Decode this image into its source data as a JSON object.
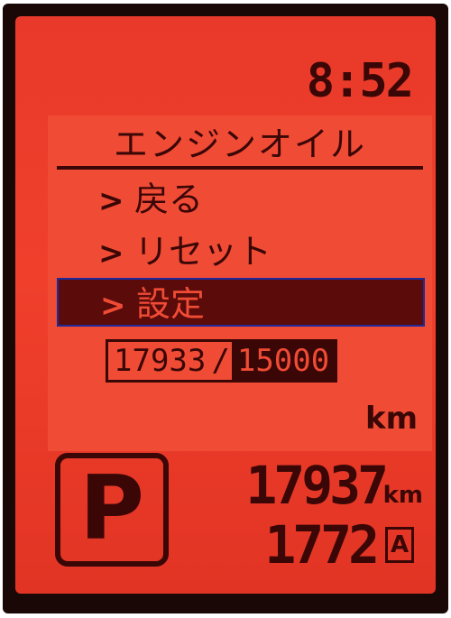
{
  "clock": {
    "time": "8:52"
  },
  "menu": {
    "title": "エンジンオイル",
    "items": [
      {
        "chevron": ">",
        "label": "戻る"
      },
      {
        "chevron": ">",
        "label": "リセット"
      },
      {
        "chevron": ">",
        "label": "設定",
        "selected": true
      }
    ]
  },
  "oil_counter": {
    "current": "17933",
    "separator": "/",
    "limit": "15000",
    "unit": "km"
  },
  "gear": {
    "indicator": "P"
  },
  "odometer": {
    "value": "17937",
    "unit": "km"
  },
  "trip": {
    "value": "1772",
    "badge": "A"
  },
  "colors": {
    "display_background": "#f04b35",
    "segment_dark": "#3a0706",
    "selection_fill": "#5a0b0a",
    "selection_border": "#1f2a9a"
  }
}
